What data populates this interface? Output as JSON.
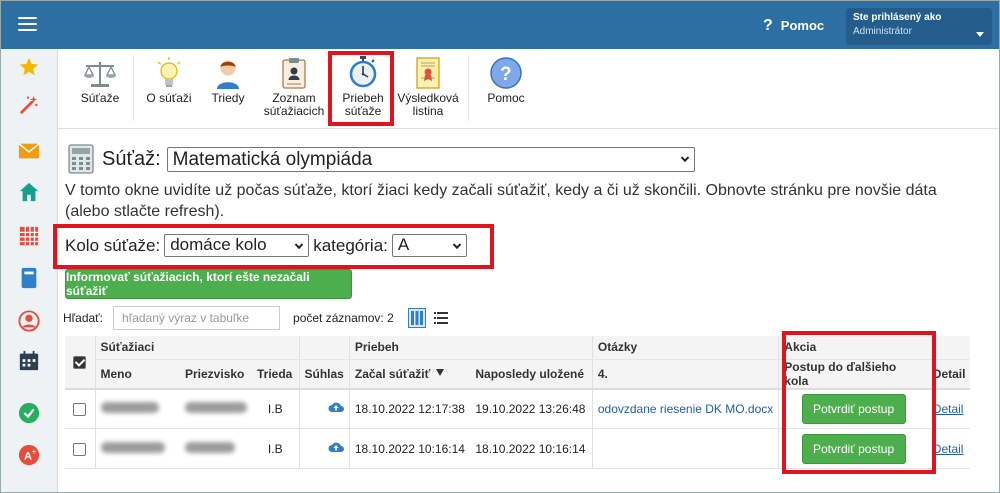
{
  "header": {
    "help_label": "Pomoc",
    "help_glyph": "?",
    "user_line1": "Ste prihlásený ako",
    "user_line2": "Administrátor",
    "colors": {
      "bar": "#2d6ea3",
      "green": "#4cae4c",
      "highlight": "#e0141e"
    }
  },
  "sidebar": {
    "icons": [
      "star-icon",
      "magic-wand-icon",
      "envelope-icon",
      "home-icon",
      "calendar-grid-icon",
      "book-icon",
      "user-circle-icon",
      "calendar-icon",
      "check-circle-icon",
      "grade-icon",
      "folder-icon"
    ]
  },
  "toolbar": {
    "items": [
      {
        "label": "Súťaže",
        "icon": "scales-icon"
      },
      {
        "label": "O súťaži",
        "icon": "lightbulb-icon"
      },
      {
        "label": "Triedy",
        "icon": "person-icon"
      },
      {
        "label": "Zoznam súťažiacich",
        "icon": "clipboard-icon"
      },
      {
        "label": "Priebeh súťaže",
        "icon": "stopwatch-icon"
      },
      {
        "label": "Výsledková listina",
        "icon": "certificate-icon"
      },
      {
        "label": "Pomoc",
        "icon": "help-circle-icon"
      }
    ]
  },
  "contest": {
    "label": "Súťaž:",
    "selected": "Matematická olympiáda"
  },
  "description": "V tomto okne uvidíte už počas súťaže, ktorí žiaci kedy začali súťažiť, kedy a či už skončili. Obnovte stránku pre novšie dáta (alebo stlačte refresh).",
  "filters": {
    "round_label": "Kolo súťaže:",
    "round_value": "domáce kolo",
    "category_label": "kategória:",
    "category_value": "A"
  },
  "notify_button": "Informovať súťažiacich, ktorí ešte nezačali súťažiť",
  "search": {
    "label": "Hľadať:",
    "placeholder": "hľadaný výraz v tabuľke",
    "count_label": "počet záznamov: 2"
  },
  "table": {
    "groups": {
      "students": "Súťažiaci",
      "progress": "Priebeh",
      "questions": "Otázky",
      "action": "Akcia"
    },
    "columns": {
      "first_name": "Meno",
      "last_name": "Priezvisko",
      "class": "Trieda",
      "consent": "Súhlas",
      "started": "Začal súťažiť",
      "last_saved": "Naposledy uložené",
      "q4": "4.",
      "advance": "Postup do ďalšieho kola",
      "detail": "Detail"
    },
    "rows": [
      {
        "class": "I.B",
        "started": "18.10.2022 12:17:38",
        "last_saved": "19.10.2022 13:26:48",
        "q4": "odovzdane riesenie DK MO.docx",
        "action": "Potvrdiť postup",
        "detail": "Detail"
      },
      {
        "class": "I.B",
        "started": "18.10.2022 10:16:14",
        "last_saved": "18.10.2022 10:16:14",
        "q4": "",
        "action": "Potvrdiť postup",
        "detail": "Detail"
      }
    ]
  }
}
